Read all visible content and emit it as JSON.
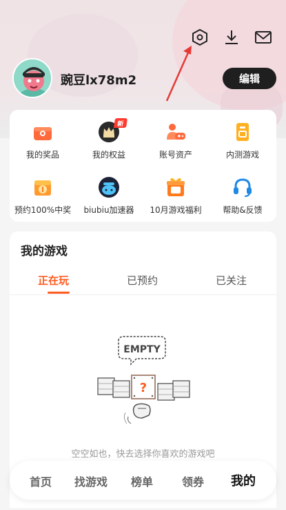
{
  "profile": {
    "username": "豌豆lx78m2",
    "edit_label": "编辑"
  },
  "top_icons": [
    "settings-icon",
    "download-icon",
    "mail-icon"
  ],
  "grid": [
    {
      "label": "我的奖品",
      "icon": "gift-box-icon"
    },
    {
      "label": "我的权益",
      "icon": "crown-icon",
      "badge": "新"
    },
    {
      "label": "账号资产",
      "icon": "gamepad-user-icon"
    },
    {
      "label": "内测游戏",
      "icon": "test-icon"
    },
    {
      "label": "预约100%中奖",
      "icon": "reserve-prize-icon"
    },
    {
      "label": "biubiu加速器",
      "icon": "biubiu-icon"
    },
    {
      "label": "10月游戏福利",
      "icon": "october-gift-icon"
    },
    {
      "label": "帮助&反馈",
      "icon": "headset-icon"
    }
  ],
  "games": {
    "title": "我的游戏",
    "tabs": [
      "正在玩",
      "已预约",
      "已关注"
    ],
    "active_tab": 0,
    "empty_art_text": "EMPTY",
    "empty_text": "空空如也，快去选择你喜欢的游戏吧"
  },
  "bottom_nav": {
    "items": [
      "首页",
      "找游戏",
      "榜单",
      "领券",
      "我的"
    ],
    "active": 4
  },
  "colors": {
    "accent": "#ff5a1f",
    "dark_button": "#1f1f1f",
    "annotation_arrow": "#e53935"
  }
}
